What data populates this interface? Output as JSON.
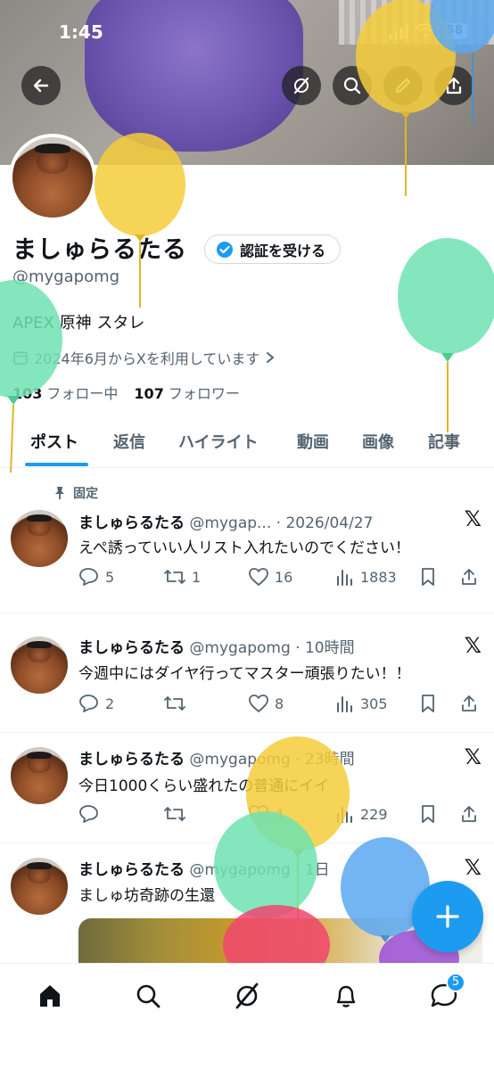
{
  "status_bar": {
    "time": "1:45",
    "battery": "58"
  },
  "profile": {
    "name": "ましゅらるたる",
    "verify_label": "認証を受ける",
    "handle": "@mygapomg",
    "bio": "APEX 原神 スタレ",
    "joined": "2024年6月からXを利用しています",
    "following_count": "103",
    "following_label": "フォロー中",
    "followers_count": "107",
    "followers_label": "フォロワー"
  },
  "tabs": [
    "ポスト",
    "返信",
    "ハイライト",
    "動画",
    "画像",
    "記事"
  ],
  "pinned_label": "固定",
  "posts": [
    {
      "name": "ましゅらるたる",
      "meta": "@mygap... · 2026/04/27",
      "text": "えぺ誘っていい人リスト入れたいのでください！",
      "replies": "5",
      "reposts": "1",
      "likes": "16",
      "views": "1883"
    },
    {
      "name": "ましゅらるたる",
      "meta": "@mygapomg · 10時間",
      "text": "今週中にはダイヤ行ってマスター頑張りたい！！",
      "replies": "2",
      "reposts": "",
      "likes": "8",
      "views": "305"
    },
    {
      "name": "ましゅらるたる",
      "meta": "@mygapomg · 23時間",
      "text": "今日1000くらい盛れたの普通にイイ",
      "replies": "",
      "reposts": "",
      "likes": "4",
      "views": "229"
    },
    {
      "name": "ましゅらるたる",
      "meta": "@mygapomg · 1日",
      "text": "ましゅ坊奇跡の生還",
      "replies": "",
      "reposts": "",
      "likes": "",
      "views": ""
    }
  ],
  "nav": {
    "messages_badge": "5"
  },
  "colors": {
    "accent": "#1d9bf0",
    "text": "#0f1419",
    "muted": "#536471"
  },
  "icons": [
    "back-arrow-icon",
    "grok-icon",
    "search-icon",
    "edit-pencil-icon",
    "share-icon",
    "verified-badge-icon",
    "calendar-icon",
    "chevron-right-icon",
    "pin-icon",
    "x-logo-icon",
    "reply-icon",
    "repost-icon",
    "like-icon",
    "views-icon",
    "bookmark-icon",
    "home-icon",
    "notifications-icon",
    "messages-icon",
    "plus-icon"
  ]
}
